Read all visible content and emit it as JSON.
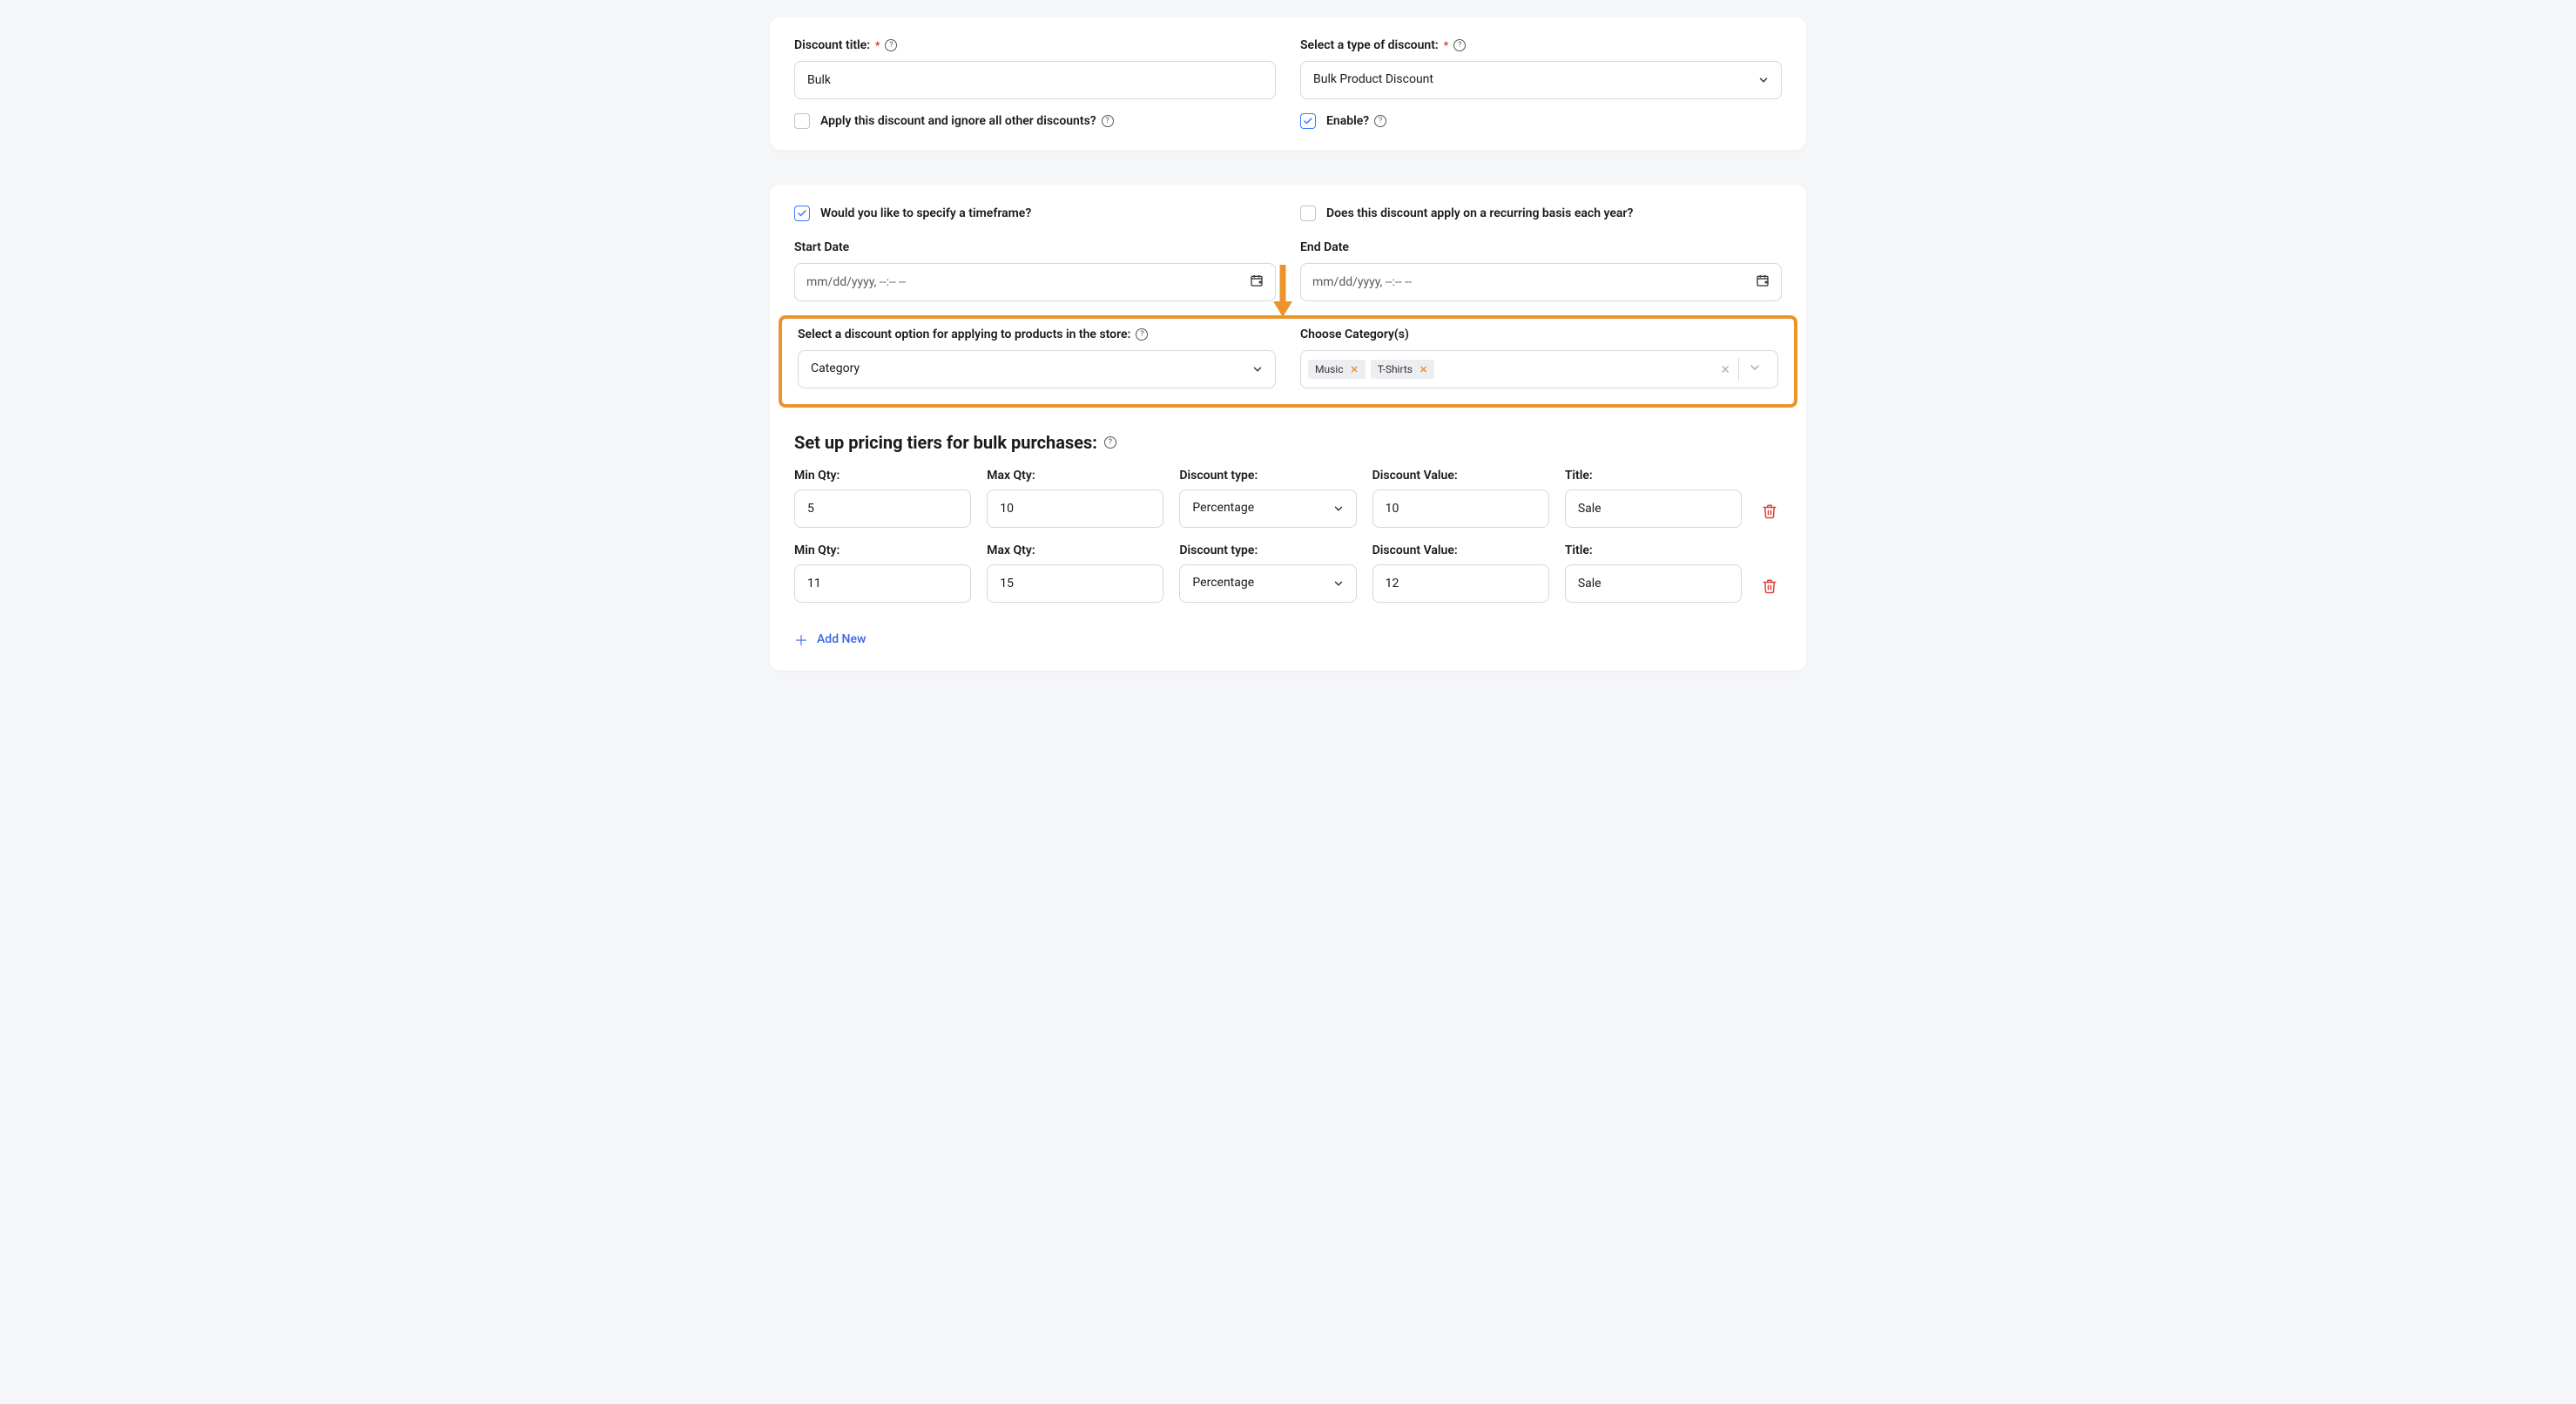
{
  "card1": {
    "discount_title_label": "Discount title:",
    "discount_title_value": "Bulk",
    "select_type_label": "Select a type of discount:",
    "select_type_value": "Bulk Product Discount",
    "ignore_others_label": "Apply this discount and ignore all other discounts?",
    "ignore_others_checked": false,
    "enable_label": "Enable?",
    "enable_checked": true
  },
  "card2": {
    "timeframe_label": "Would you like to specify a timeframe?",
    "timeframe_checked": true,
    "recurring_label": "Does this discount apply on a recurring basis each year?",
    "recurring_checked": false,
    "start_date_label": "Start Date",
    "end_date_label": "End Date",
    "date_placeholder": "mm/dd/yyyy, --:-- --",
    "discount_option_label": "Select a discount option for applying to products in the store:",
    "discount_option_value": "Category",
    "choose_category_label": "Choose Category(s)",
    "category_tags": [
      "Music",
      "T-Shirts"
    ],
    "tiers_heading": "Set up pricing tiers for bulk purchases:",
    "tier_labels": {
      "min_qty": "Min Qty:",
      "max_qty": "Max Qty:",
      "discount_type": "Discount type:",
      "discount_value": "Discount Value:",
      "title": "Title:"
    },
    "tiers": [
      {
        "min": "5",
        "max": "10",
        "type": "Percentage",
        "value": "10",
        "title": "Sale"
      },
      {
        "min": "11",
        "max": "15",
        "type": "Percentage",
        "value": "12",
        "title": "Sale"
      }
    ],
    "add_new_label": "Add New"
  }
}
